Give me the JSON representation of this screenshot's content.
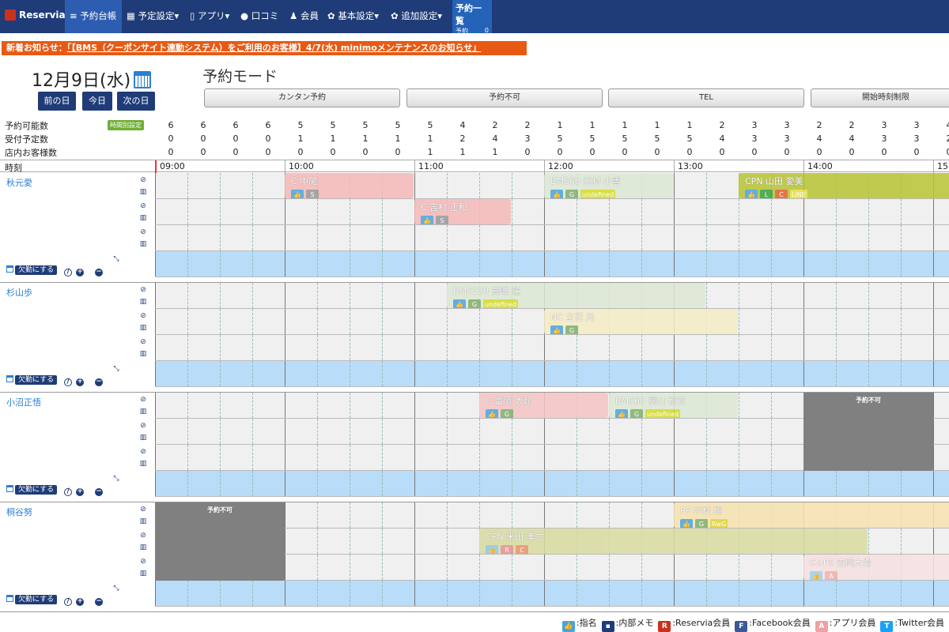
{
  "nav": {
    "logo": "Reservia",
    "menus": [
      "予約台帳",
      "予定設定▾",
      "アプリ▾",
      "口コミ",
      "会員",
      "基本設定▾",
      "追加設定▾"
    ],
    "rsvlist": {
      "title": "予約一覧",
      "reserve_label": "予約",
      "reserve_count": "0",
      "cancel_label": "取消",
      "cancel_count": "0"
    }
  },
  "notice": {
    "label": "新着お知らせ：",
    "text": "「【BMS（クーポンサイト連動システム）をご利用のお客様】4/7(水) minimoメンテナンスのお知らせ」"
  },
  "date": "12月9日(水)",
  "date_nav": {
    "prev": "前の日",
    "today": "今日",
    "next": "次の日"
  },
  "mode_title": "予約モード",
  "mode_buttons": [
    "カンタン予約",
    "予約不可",
    "TEL",
    "開始時刻制限"
  ],
  "summary": {
    "labels": [
      "予約可能数",
      "受付予定数",
      "店内お客様数"
    ],
    "time_badge": "時間別設定",
    "available": [
      "6",
      "6",
      "6",
      "6",
      "5",
      "5",
      "5",
      "5",
      "5",
      "4",
      "2",
      "2",
      "1",
      "1",
      "1",
      "1",
      "1",
      "2",
      "3",
      "3",
      "2",
      "2",
      "3",
      "3",
      "4"
    ],
    "scheduled": [
      "0",
      "0",
      "0",
      "0",
      "1",
      "1",
      "1",
      "1",
      "1",
      "2",
      "4",
      "3",
      "5",
      "5",
      "5",
      "5",
      "5",
      "4",
      "3",
      "3",
      "4",
      "4",
      "3",
      "3",
      "2"
    ],
    "in_store": [
      "0",
      "0",
      "0",
      "0",
      "0",
      "0",
      "0",
      "0",
      "1",
      "1",
      "1",
      "0",
      "0",
      "0",
      "0",
      "0",
      "0",
      "0",
      "0",
      "0",
      "0",
      "0",
      "0",
      "0",
      "0"
    ]
  },
  "time_header": {
    "label": "時刻",
    "hours": [
      "09:00",
      "10:00",
      "11:00",
      "12:00",
      "13:00",
      "14:00",
      "15:"
    ]
  },
  "absent_label": "欠勤にする",
  "unavailable_label": "予約不可",
  "staff": [
    {
      "name": "秋元愛",
      "bookings": [
        {
          "row": 0,
          "start": 4,
          "span": 4,
          "color": "#f5b8b8",
          "title": "C 中尾",
          "tags": [
            {
              "t": "👍",
              "c": "#4aa3df"
            },
            {
              "t": "S",
              "c": "#999"
            }
          ]
        },
        {
          "row": 1,
          "start": 8,
          "span": 3,
          "color": "#f5b8b8",
          "title": "C 吉村 正和",
          "tags": [
            {
              "t": "👍",
              "c": "#4aa3df"
            },
            {
              "t": "S",
              "c": "#999"
            }
          ]
        },
        {
          "row": 0,
          "start": 12,
          "span": 4,
          "color": "#dde8d4",
          "title": "BMS60 田村 小雪",
          "tags": [
            {
              "t": "👍",
              "c": "#4aa3df"
            },
            {
              "t": "G",
              "c": "#7fb069"
            },
            {
              "t": "undefined",
              "c": "#d4dc28"
            }
          ]
        },
        {
          "row": 0,
          "start": 18,
          "span": 7,
          "color": "#b8c434",
          "title": "CPN 山田 愛美",
          "tags": [
            {
              "t": "👍",
              "c": "#4aa3df"
            },
            {
              "t": "L",
              "c": "#35a33a"
            },
            {
              "t": "C",
              "c": "#e5602a"
            },
            {
              "t": "LINE",
              "c": "#e8e03a"
            }
          ]
        }
      ],
      "blocks": []
    },
    {
      "name": "杉山歩",
      "bookings": [
        {
          "row": 0,
          "start": 9,
          "span": 8,
          "color": "#dde8d4",
          "title": "BMS120 高峰 蓮",
          "tags": [
            {
              "t": "👍",
              "c": "#4aa3df"
            },
            {
              "t": "G",
              "c": "#7fb069"
            },
            {
              "t": "undefined",
              "c": "#d4dc28"
            }
          ]
        },
        {
          "row": 1,
          "start": 12,
          "span": 6,
          "color": "#f5ecc4",
          "title": "NC 立花 光",
          "tags": [
            {
              "t": "👍",
              "c": "#4aa3df"
            },
            {
              "t": "G",
              "c": "#7fb069"
            }
          ]
        }
      ],
      "blocks": []
    },
    {
      "name": "小沼正悟",
      "bookings": [
        {
          "row": 0,
          "start": 10,
          "span": 4,
          "color": "#f5c4c4",
          "title": "C 富岡 太郎",
          "tags": [
            {
              "t": "👍",
              "c": "#4aa3df"
            },
            {
              "t": "G",
              "c": "#7fb069"
            }
          ]
        },
        {
          "row": 0,
          "start": 14,
          "span": 4,
          "color": "#dde8d4",
          "title": "BMS60 福山 秋吉",
          "tags": [
            {
              "t": "👍",
              "c": "#4aa3df"
            },
            {
              "t": "G",
              "c": "#7fb069"
            },
            {
              "t": "undefined",
              "c": "#d4dc28"
            }
          ]
        }
      ],
      "blocks": [
        {
          "start": 20,
          "span": 4,
          "rows": 3
        }
      ]
    },
    {
      "name": "桐谷努",
      "bookings": [
        {
          "row": 0,
          "start": 16,
          "span": 9,
          "color": "#f8e2b0",
          "title": "PP 中村 翔",
          "tags": [
            {
              "t": "👍",
              "c": "#4aa3df"
            },
            {
              "t": "G",
              "c": "#7fb069"
            },
            {
              "t": "RwG",
              "c": "#e0d430"
            }
          ]
        },
        {
          "row": 1,
          "start": 10,
          "span": 12,
          "color": "#d8dca0",
          "title": "CPN 米田 孝之",
          "tags": [
            {
              "t": "👍",
              "c": "#8cc8e8"
            },
            {
              "t": "R",
              "c": "#e89090"
            },
            {
              "t": "C",
              "c": "#e8936a"
            }
          ]
        },
        {
          "row": 2,
          "start": 20,
          "span": 5,
          "color": "#f7e0e0",
          "title": "C+PS 吉岡大希",
          "tags": [
            {
              "t": "👍",
              "c": "#a0d0ee"
            },
            {
              "t": "A",
              "c": "#f0b0b0"
            }
          ]
        }
      ],
      "blocks": [
        {
          "start": 0,
          "span": 4,
          "rows": 3
        }
      ]
    }
  ],
  "legend": [
    {
      "icon": "👍",
      "color": "#4aa3df",
      "label": ":指名"
    },
    {
      "icon": "▪",
      "color": "#1f3c78",
      "label": ":内部メモ"
    },
    {
      "icon": "R",
      "color": "#c8321e",
      "label": ":Reservia会員"
    },
    {
      "icon": "F",
      "color": "#3b5998",
      "label": ":Facebook会員"
    },
    {
      "icon": "A",
      "color": "#f0a0a0",
      "label": ":アプリ会員"
    },
    {
      "icon": "T",
      "color": "#1da1f2",
      "label": ":Twitter会員"
    }
  ]
}
